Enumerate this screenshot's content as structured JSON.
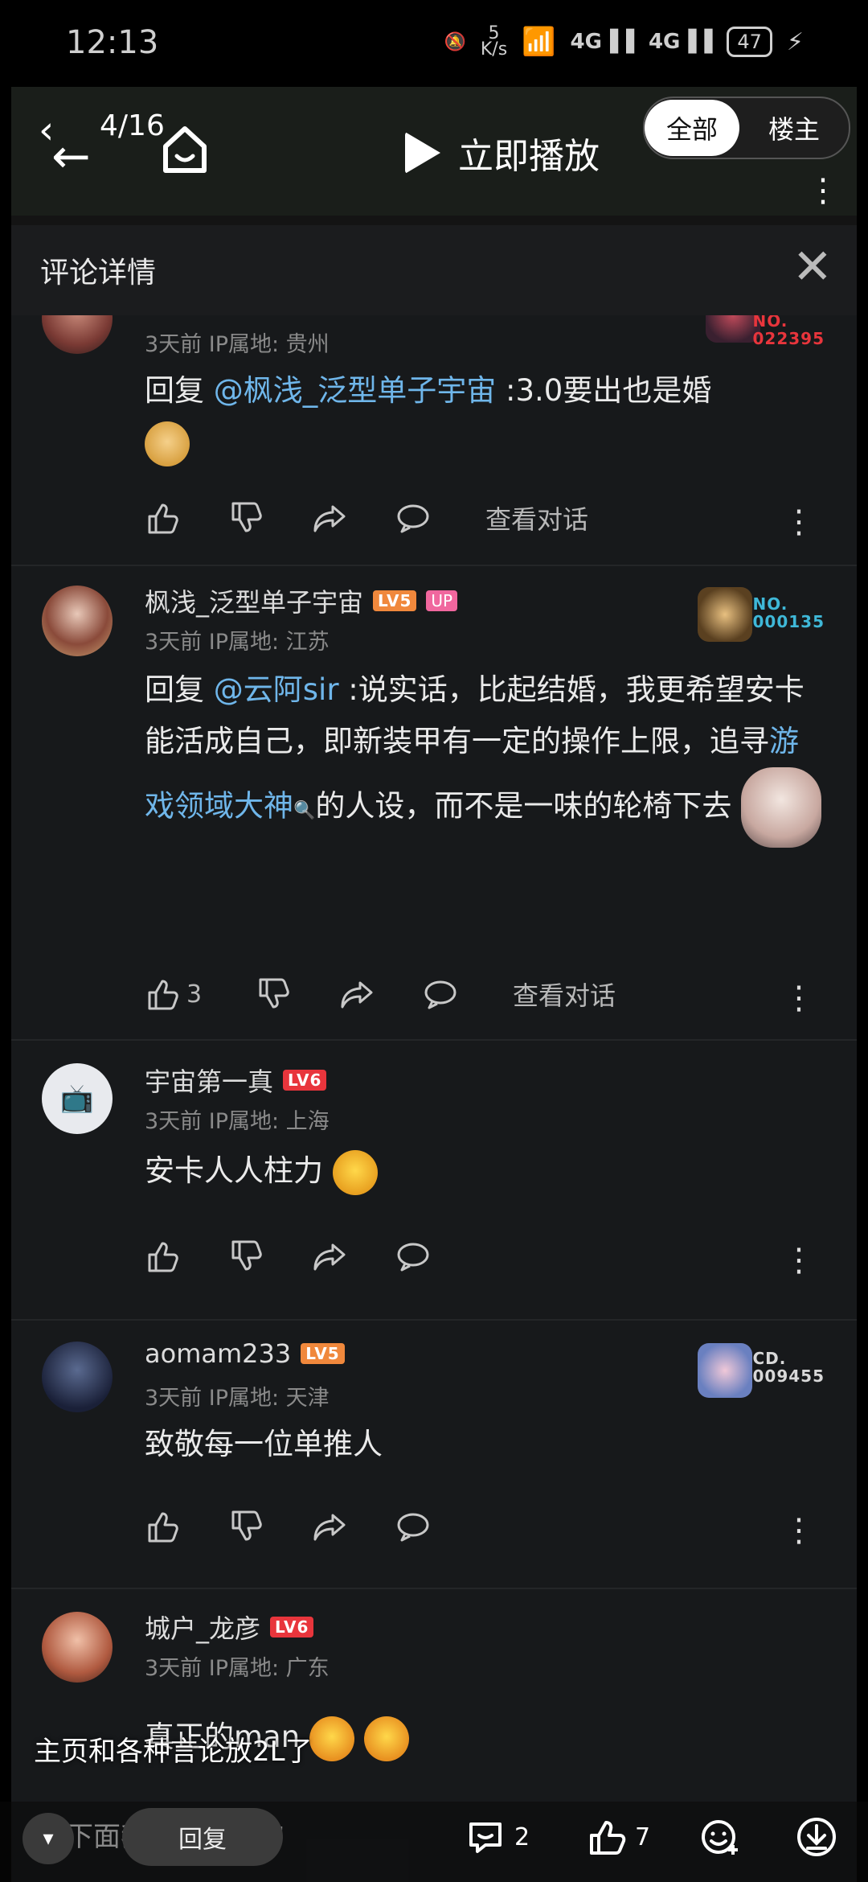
{
  "status_bar": {
    "time": "12:13",
    "speed_top": "5",
    "speed_unit": "K/s",
    "battery": "47"
  },
  "video_bar": {
    "pager": "4/16",
    "play_label": "立即播放",
    "seg_all": "全部",
    "seg_op": "楼主"
  },
  "panel": {
    "title": "评论详情"
  },
  "comments": [
    {
      "meta": "3天前 IP属地: 贵州",
      "reply_prefix": "回复 ",
      "mention": "@枫浅_泛型单子宇宙",
      "text": " :3.0要出也是婚",
      "actions": {
        "view": "查看对话"
      },
      "badge": [
        "NO.",
        "022395"
      ]
    },
    {
      "name": "枫浅_泛型单子宇宙",
      "level": "LV5",
      "up": "UP",
      "meta": "3天前 IP属地: 江苏",
      "reply_prefix": "回复 ",
      "mention": "@云阿sir",
      "text1": " :说实话，比起结婚，我更希望安卡能活成自己，即新装甲有一定的操作上限，追寻",
      "link": "游戏领域大神",
      "text2": "的人设，而不是一味的轮椅下去",
      "like_count": "3",
      "actions": {
        "view": "查看对话"
      },
      "badge": [
        "NO.",
        "000135"
      ]
    },
    {
      "name": "宇宙第一真",
      "level": "LV6",
      "meta": "3天前 IP属地: 上海",
      "text": "安卡人人柱力"
    },
    {
      "name": "aomam233",
      "level": "LV5",
      "meta": "3天前 IP属地: 天津",
      "text": "致敬每一位单推人",
      "badge": [
        "CD.",
        "009455"
      ]
    },
    {
      "name": "城户_龙彦",
      "level": "LV6",
      "meta": "3天前 IP属地: 广东",
      "text": "真正的man"
    }
  ],
  "toast": "主页和各种言论放2L了",
  "bottom_bar": {
    "danmu_placeholder": "下面我简单喵两句",
    "reply_label": "回复",
    "comment_count": "2",
    "like_count": "7"
  },
  "colors": {
    "accent_blue": "#6fb6ea",
    "lv5": "#f0883c",
    "lv6": "#e8353c",
    "up_pink": "#f0679e",
    "badge_red": "#e8353c",
    "badge_cyan": "#3fb8d8"
  }
}
